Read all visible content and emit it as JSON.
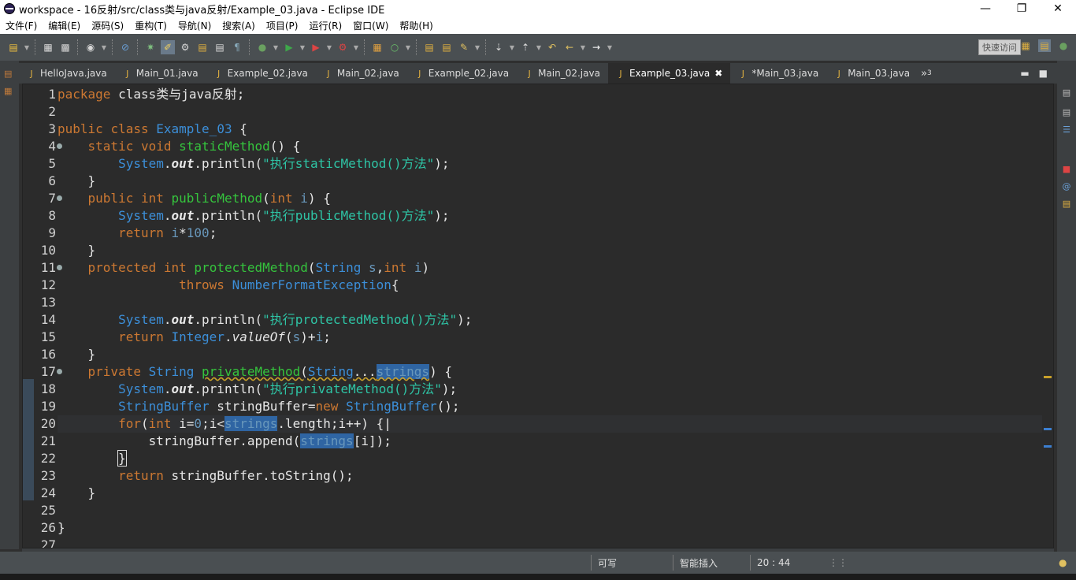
{
  "window": {
    "title": "workspace - 16反射/src/class类与java反射/Example_03.java - Eclipse IDE"
  },
  "menu": [
    "文件(F)",
    "编辑(E)",
    "源码(S)",
    "重构(T)",
    "导航(N)",
    "搜索(A)",
    "项目(P)",
    "运行(R)",
    "窗口(W)",
    "帮助(H)"
  ],
  "toolbar": {
    "quick_access": "快速访问"
  },
  "tabs": [
    {
      "label": "HelloJava.java",
      "active": false
    },
    {
      "label": "Main_01.java",
      "active": false
    },
    {
      "label": "Example_02.java",
      "active": false
    },
    {
      "label": "Main_02.java",
      "active": false
    },
    {
      "label": "Example_02.java",
      "active": false
    },
    {
      "label": "Main_02.java",
      "active": false
    },
    {
      "label": "Example_03.java",
      "active": true
    },
    {
      "label": "*Main_03.java",
      "active": false
    },
    {
      "label": "Main_03.java",
      "active": false
    }
  ],
  "tabs_more": "»",
  "tabs_more_count": "3",
  "code": [
    {
      "n": "1",
      "fold": false
    },
    {
      "n": "2",
      "fold": false
    },
    {
      "n": "3",
      "fold": false
    },
    {
      "n": "4",
      "fold": true
    },
    {
      "n": "5",
      "fold": false
    },
    {
      "n": "6",
      "fold": false
    },
    {
      "n": "7",
      "fold": true
    },
    {
      "n": "8",
      "fold": false
    },
    {
      "n": "9",
      "fold": false
    },
    {
      "n": "10",
      "fold": false
    },
    {
      "n": "11",
      "fold": true
    },
    {
      "n": "12",
      "fold": false
    },
    {
      "n": "13",
      "fold": false
    },
    {
      "n": "14",
      "fold": false
    },
    {
      "n": "15",
      "fold": false
    },
    {
      "n": "16",
      "fold": false
    },
    {
      "n": "17",
      "fold": true
    },
    {
      "n": "18",
      "fold": false
    },
    {
      "n": "19",
      "fold": false
    },
    {
      "n": "20",
      "fold": false
    },
    {
      "n": "21",
      "fold": false
    },
    {
      "n": "22",
      "fold": false
    },
    {
      "n": "23",
      "fold": false
    },
    {
      "n": "24",
      "fold": false
    },
    {
      "n": "25",
      "fold": false
    },
    {
      "n": "26",
      "fold": false
    },
    {
      "n": "27",
      "fold": false
    }
  ],
  "status": {
    "writable": "可写",
    "insert_mode": "智能插入",
    "position": "20 : 44"
  },
  "colors": {
    "keyword": "#cc7832",
    "class": "#3c8fd9",
    "method": "#35c43d",
    "string": "#2ec4a5",
    "selection": "#2f65a3"
  }
}
